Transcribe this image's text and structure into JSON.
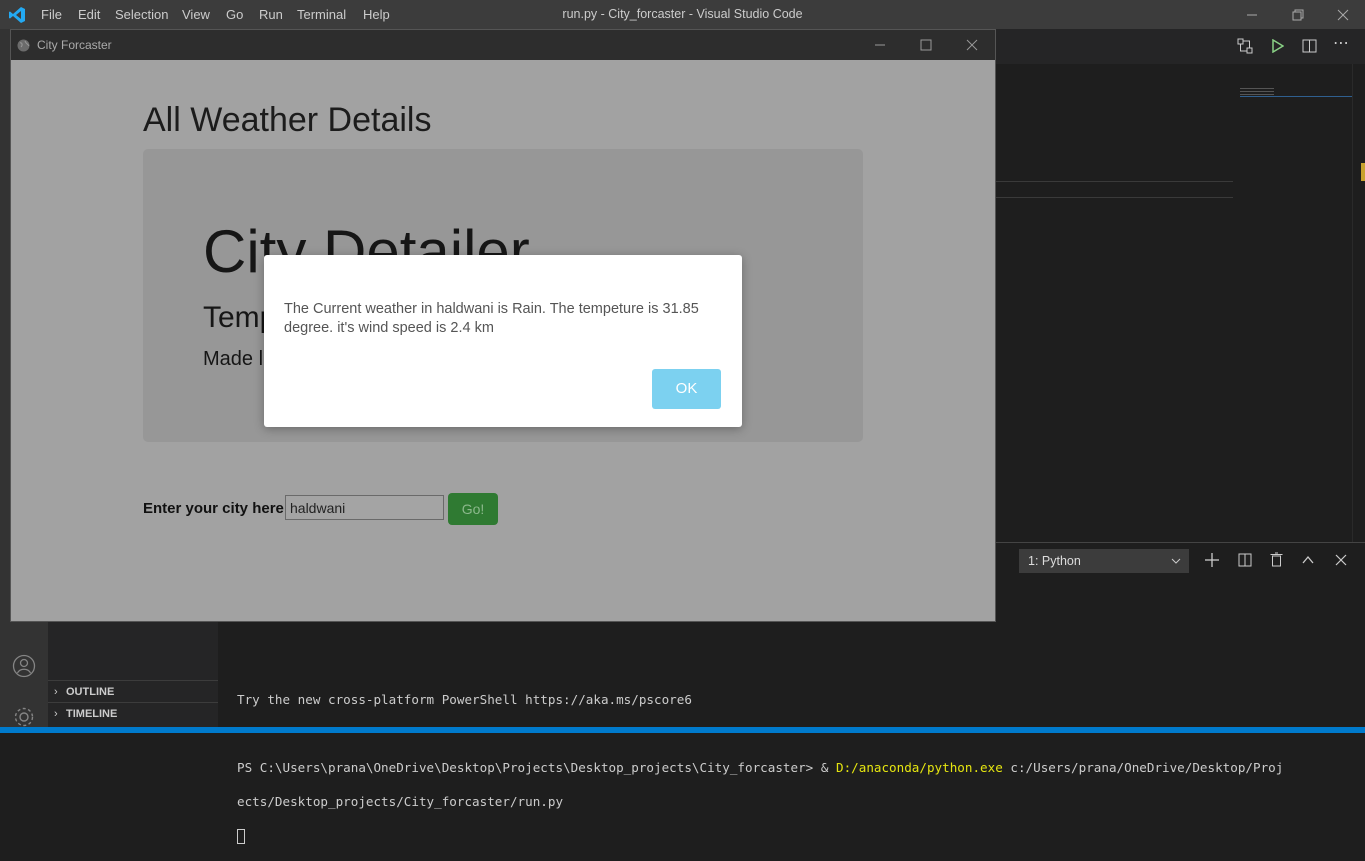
{
  "vscode": {
    "menu": [
      "File",
      "Edit",
      "Selection",
      "View",
      "Go",
      "Run",
      "Terminal",
      "Help"
    ],
    "window_title": "run.py - City_forcaster - Visual Studio Code",
    "terminal_select": "1: Python",
    "sidebar_sections": {
      "outline": "OUTLINE",
      "timeline": "TIMELINE"
    },
    "terminal": {
      "line1": "Try the new cross-platform PowerShell https://aka.ms/pscore6",
      "prompt": "PS C:\\Users\\prana\\OneDrive\\Desktop\\Projects\\Desktop_projects\\City_forcaster> & ",
      "python_exe": "D:/anaconda/python.exe",
      "script_part1": " c:/Users/prana/OneDrive/Desktop/Proj",
      "script_part2": "ects/Desktop_projects/City_forcaster/run.py"
    },
    "accent_color": "#007acc"
  },
  "app": {
    "window_title": "City Forcaster",
    "heading": "All Weather Details",
    "jumbotron": {
      "title": "City Detailer",
      "temp_label": "Temp",
      "made_label": "Made l"
    },
    "form": {
      "label": "Enter your city here",
      "input_value": "haldwani",
      "go_label": "Go!"
    }
  },
  "alert": {
    "message": "The Current weather in haldwani is Rain. The tempeture is 31.85 degree. it's wind speed is 2.4 km",
    "ok_label": "OK"
  }
}
